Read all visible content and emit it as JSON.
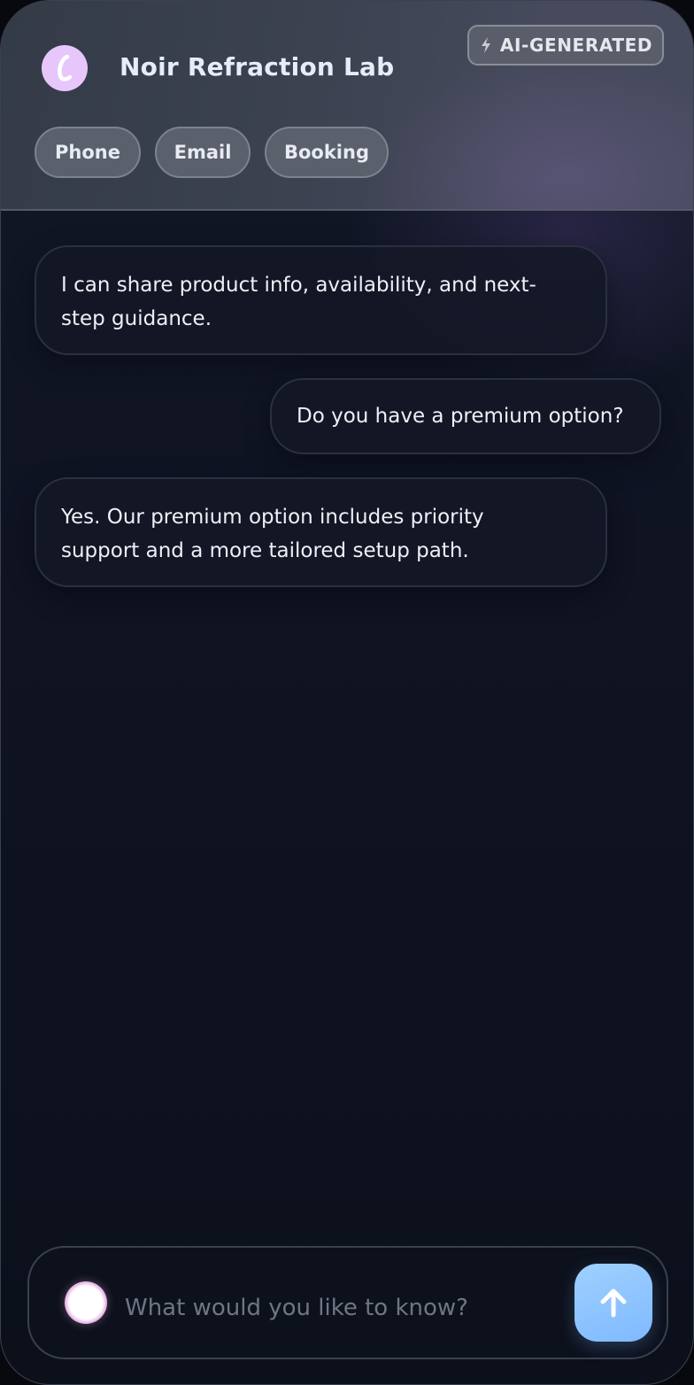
{
  "header": {
    "title": "Noir Refraction Lab",
    "badge": "AI-GENERATED",
    "chips": [
      "Phone",
      "Email",
      "Booking"
    ]
  },
  "messages": [
    {
      "role": "assistant",
      "text": "I can share product info, availability, and next-step guidance."
    },
    {
      "role": "user",
      "text": "Do you have a premium option?"
    },
    {
      "role": "assistant",
      "text": "Yes. Our premium option includes priority support and a more tailored setup path."
    }
  ],
  "composer": {
    "placeholder": "What would you like to know?",
    "value": ""
  },
  "icons": {
    "logo": "brand-logo-icon",
    "badge": "lightning-icon",
    "mic": "voice-orb-icon",
    "send": "arrow-up-icon"
  },
  "colors": {
    "accent": "#8cc4ff",
    "logo_bg": "#e7c7fb"
  }
}
